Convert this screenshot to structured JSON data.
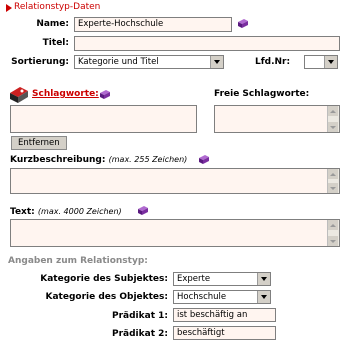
{
  "section_title": "Relationstyp-Daten",
  "fields": {
    "name_label": "Name:",
    "name_value": "Experte-Hochschule",
    "titel_label": "Titel:",
    "titel_value": "",
    "sortierung_label": "Sortierung:",
    "sortierung_value": "Kategorie und Titel",
    "lfdnr_label": "Lfd.Nr:",
    "lfdnr_value": ""
  },
  "schlagworte": {
    "label": "Schlagworte:",
    "freie_label": "Freie Schlagworte:",
    "remove_button": "Entfernen"
  },
  "kurzbeschreibung": {
    "label": "Kurzbeschreibung:",
    "hint": "(max. 255 Zeichen)"
  },
  "text": {
    "label": "Text:",
    "hint": "(max. 4000 Zeichen)"
  },
  "relation": {
    "title": "Angaben zum Relationstyp:",
    "subjekt_label": "Kategorie des Subjektes:",
    "subjekt_value": "Experte",
    "objekt_label": "Kategorie des Objektes:",
    "objekt_value": "Hochschule",
    "praedikat1_label": "Prädikat 1:",
    "praedikat1_value": "ist beschäftig an",
    "praedikat2_label": "Prädikat 2:",
    "praedikat2_value": "beschäftigt"
  },
  "colors": {
    "accent_red": "#cc0000",
    "field_bg": "#fff5f0",
    "book_purple": "#7b2fa0"
  }
}
